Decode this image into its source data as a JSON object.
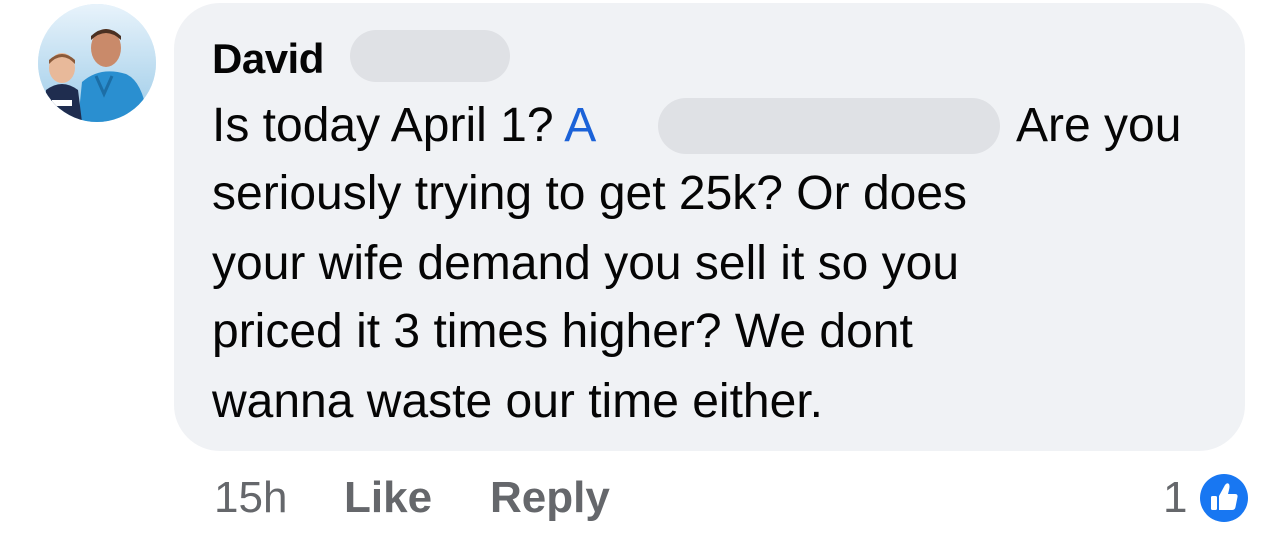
{
  "comment": {
    "author": "David",
    "text_lines": [
      "Is today April 1? ",
      "seriously trying to get 25k?  Or does",
      "your wife demand you sell it so you",
      "priced it 3 times higher?  We dont",
      "wanna waste our time either."
    ],
    "mention_visible": "A",
    "line1_tail": "Are you"
  },
  "footer": {
    "time": "15h",
    "like_label": "Like",
    "reply_label": "Reply",
    "reaction_count": "1"
  },
  "icons": {
    "avatar": "profile-photo",
    "reaction": "thumbs-up-icon"
  },
  "colors": {
    "bubble": "#f0f2f5",
    "mention": "#1b62d8",
    "meta_text": "#65676b",
    "like_badge": "#1877f2"
  }
}
